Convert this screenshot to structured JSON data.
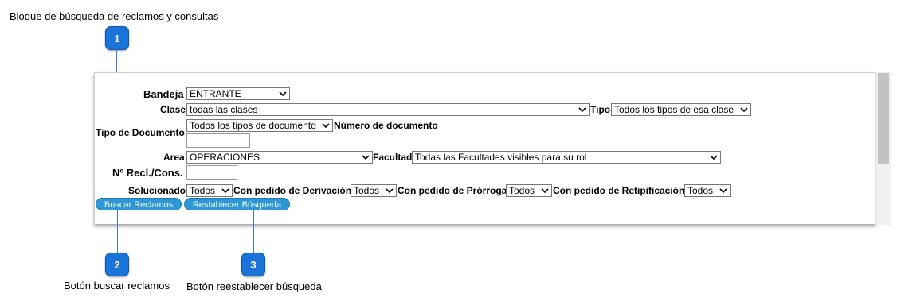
{
  "doc": {
    "title": "Bloque de búsqueda de reclamos y consultas"
  },
  "callouts": [
    {
      "number": "1"
    },
    {
      "number": "2",
      "caption": "Botón buscar reclamos"
    },
    {
      "number": "3",
      "caption": "Botón reestablecer búsqueda"
    }
  ],
  "form": {
    "bandeja": {
      "label": "Bandeja",
      "value": "ENTRANTE"
    },
    "clase": {
      "label": "Clase",
      "value": "todas las clases"
    },
    "tipo": {
      "label": "Tipo",
      "value": "Todos los tipos de esa clase"
    },
    "tipo_documento": {
      "label": "Tipo de Documento",
      "value": "Todos los tipos de documento"
    },
    "numero_documento": {
      "label": "Número de documento",
      "value": ""
    },
    "area": {
      "label": "Area",
      "value": "OPERACIONES"
    },
    "facultad": {
      "label": "Facultad",
      "value": "Todas las Facultades visibles para su rol"
    },
    "recl": {
      "label": "Nº Recl./Cons.",
      "value": ""
    },
    "solucionado": {
      "label": "Solucionado",
      "value": "Todos"
    },
    "derivacion": {
      "label": "Con pedido de Derivación",
      "value": "Todos"
    },
    "prorroga": {
      "label": "Con pedido de Prórroga",
      "value": "Todos"
    },
    "retipificacion": {
      "label": "Con pedido de Retipificación",
      "value": "Todos"
    },
    "buttons": {
      "buscar": "Buscar Reclamos",
      "restablecer": "Restablecer Búsqueda"
    }
  },
  "colors": {
    "callout": "#1a73d9",
    "button": "#2e97d6"
  },
  "icons": {
    "select_arrow": "chevron-down-icon"
  }
}
